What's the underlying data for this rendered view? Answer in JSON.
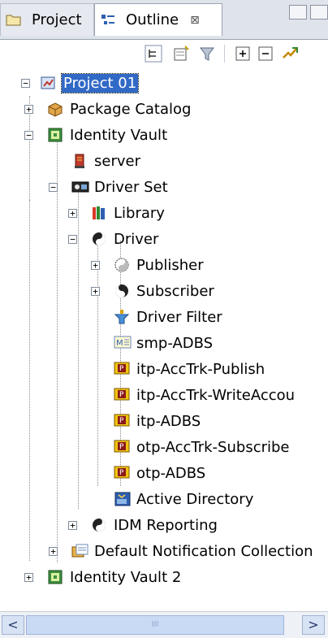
{
  "tabs": [
    {
      "label": "Project",
      "icon": "folder-icon",
      "active": false
    },
    {
      "label": "Outline",
      "icon": "outline-icon",
      "active": true,
      "close_glyph": "⊠"
    }
  ],
  "toolbar": {
    "buttons": [
      "hierarchy-view-icon",
      "new-item-icon",
      "filter-icon",
      "expand-all-icon",
      "collapse-all-icon",
      "deploy-icon"
    ]
  },
  "tree": {
    "items": [
      {
        "label": "Project 01",
        "icon": "project-icon",
        "expander": "−",
        "selected": true
      },
      {
        "label": "Package Catalog",
        "icon": "package-icon",
        "expander": "+"
      },
      {
        "label": "Identity Vault",
        "icon": "vault-icon",
        "expander": "−"
      },
      {
        "label": "server",
        "icon": "server-icon",
        "expander": ""
      },
      {
        "label": "Driver Set",
        "icon": "driverset-icon",
        "expander": "−"
      },
      {
        "label": "Library",
        "icon": "library-icon",
        "expander": "+"
      },
      {
        "label": "Driver",
        "icon": "driver-icon",
        "expander": "−"
      },
      {
        "label": "Publisher",
        "icon": "publisher-icon",
        "expander": "+"
      },
      {
        "label": "Subscriber",
        "icon": "subscriber-icon",
        "expander": "+"
      },
      {
        "label": "Driver Filter",
        "icon": "filter-icon",
        "expander": ""
      },
      {
        "label": "smp-ADBS",
        "icon": "mapping-icon",
        "expander": ""
      },
      {
        "label": "itp-AccTrk-Publish",
        "icon": "policy-icon",
        "expander": ""
      },
      {
        "label": "itp-AccTrk-WriteAccou",
        "icon": "policy-icon",
        "expander": ""
      },
      {
        "label": "itp-ADBS",
        "icon": "policy-icon",
        "expander": ""
      },
      {
        "label": "otp-AccTrk-Subscribe",
        "icon": "policy-icon",
        "expander": ""
      },
      {
        "label": "otp-ADBS",
        "icon": "policy-icon",
        "expander": ""
      },
      {
        "label": "Active Directory",
        "icon": "application-icon",
        "expander": ""
      },
      {
        "label": "IDM Reporting",
        "icon": "driver-icon",
        "expander": "+"
      },
      {
        "label": "Default Notification Collection",
        "icon": "notification-icon",
        "expander": "+"
      },
      {
        "label": "Identity Vault 2",
        "icon": "vault-icon",
        "expander": "+"
      }
    ]
  },
  "scrollbar": {
    "left_glyph": "<",
    "right_glyph": ">",
    "thumb_grip": "III"
  },
  "colors": {
    "selection": "#3169c6",
    "tab_bar": "#dfe3ea"
  }
}
